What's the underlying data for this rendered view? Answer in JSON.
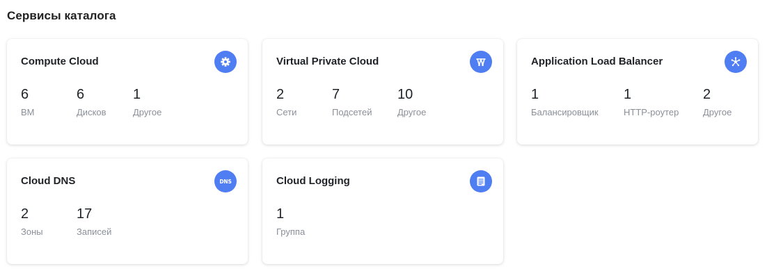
{
  "page": {
    "title": "Сервисы каталога"
  },
  "colors": {
    "icon_bg": "#4f7df2",
    "label": "#8a8f98",
    "text": "#1f2328"
  },
  "cards": [
    {
      "title": "Compute Cloud",
      "icon": "gear-icon",
      "stats": [
        {
          "value": "6",
          "label": "ВМ"
        },
        {
          "value": "6",
          "label": "Дисков"
        },
        {
          "value": "1",
          "label": "Другое"
        }
      ]
    },
    {
      "title": "Virtual Private Cloud",
      "icon": "network-icon",
      "stats": [
        {
          "value": "2",
          "label": "Сети"
        },
        {
          "value": "7",
          "label": "Подсетей"
        },
        {
          "value": "10",
          "label": "Другое"
        }
      ]
    },
    {
      "title": "Application Load Balancer",
      "icon": "load-balancer-icon",
      "stats": [
        {
          "value": "1",
          "label": "Балансировщик"
        },
        {
          "value": "1",
          "label": "HTTP-роутер"
        },
        {
          "value": "2",
          "label": "Другое"
        }
      ]
    },
    {
      "title": "Cloud DNS",
      "icon": "dns-icon",
      "icon_text": "DNS",
      "stats": [
        {
          "value": "2",
          "label": "Зоны"
        },
        {
          "value": "17",
          "label": "Записей"
        }
      ]
    },
    {
      "title": "Cloud Logging",
      "icon": "document-lines-icon",
      "stats": [
        {
          "value": "1",
          "label": "Группа"
        }
      ]
    }
  ]
}
